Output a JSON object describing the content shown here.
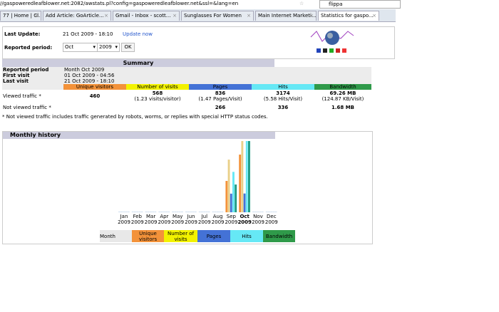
{
  "browser": {
    "url": "//gaspoweredleafblower.net:2082/awstats.pl?config=gaspoweredleafblower.net&ssl=&lang=en",
    "search": "flippa",
    "tabs": [
      {
        "label": "77 | Home | Cl..."
      },
      {
        "label": "Add Article: GoArticle..."
      },
      {
        "label": "Gmail - Inbox - scott..."
      },
      {
        "label": "Sunglasses For Women"
      },
      {
        "label": "Main Internet Marketi..."
      },
      {
        "label": "Statistics for gaspo...",
        "active": true
      }
    ]
  },
  "header": {
    "last_update_label": "Last Update:",
    "last_update": "21 Oct 2009 - 18:10",
    "update_now": "Update now",
    "period_label": "Reported period:",
    "month": "Oct",
    "year": "2009",
    "ok": "OK"
  },
  "summary": {
    "title": "Summary",
    "reported_period_label": "Reported period",
    "reported_period": "Month Oct 2009",
    "first_visit_label": "First visit",
    "first_visit": "01 Oct 2009 - 04:56",
    "last_visit_label": "Last visit",
    "last_visit": "21 Oct 2009 - 18:10",
    "columns": [
      "Unique visitors",
      "Number of visits",
      "Pages",
      "Hits",
      "Bandwidth"
    ],
    "viewed_label": "Viewed traffic *",
    "viewed": [
      "460",
      "568",
      "836",
      "3174",
      "69.26 MB"
    ],
    "viewed_sub": [
      "",
      "(1.23 visits/visitor)",
      "(1.47 Pages/Visit)",
      "(5.58 Hits/Visit)",
      "(124.87 KB/Visit)"
    ],
    "not_viewed_label": "Not viewed traffic *",
    "not_viewed": [
      "",
      "",
      "266",
      "336",
      "1.68 MB"
    ],
    "footnote": "* Not viewed traffic includes traffic generated by robots, worms, or replies with special HTTP status codes."
  },
  "colors": {
    "unique": "#f3923a",
    "visits": "#f2f200",
    "visits_bar": "#ead089",
    "pages": "#4472d6",
    "hits": "#66e8f5",
    "bandwidth": "#2f9a4a",
    "bandwidth_bar": "#1f9a83"
  },
  "chart_data": {
    "type": "bar",
    "title": "Monthly history",
    "categories": [
      "Jan 2009",
      "Feb 2009",
      "Mar 2009",
      "Apr 2009",
      "May 2009",
      "Jun 2009",
      "Jul 2009",
      "Aug 2009",
      "Sep 2009",
      "Oct 2009",
      "Nov 2009",
      "Dec 2009"
    ],
    "month_labels": [
      "Jan",
      "Feb",
      "Mar",
      "Apr",
      "May",
      "Jun",
      "Jul",
      "Aug",
      "Sep",
      "Oct",
      "Nov",
      "Dec"
    ],
    "year_label": "2009",
    "highlight": "Oct",
    "series": [
      {
        "name": "Unique visitors",
        "values": [
          0,
          0,
          0,
          0,
          0,
          0,
          0,
          0,
          250,
          460,
          0,
          0
        ]
      },
      {
        "name": "Number of visits",
        "values": [
          0,
          0,
          0,
          0,
          0,
          0,
          0,
          0,
          420,
          568,
          0,
          0
        ]
      },
      {
        "name": "Pages",
        "values": [
          0,
          0,
          0,
          0,
          0,
          0,
          0,
          0,
          830,
          836,
          0,
          0
        ]
      },
      {
        "name": "Hits",
        "values": [
          0,
          0,
          0,
          0,
          0,
          0,
          0,
          0,
          1800,
          3174,
          0,
          0
        ]
      },
      {
        "name": "Bandwidth (MB)",
        "values": [
          0,
          0,
          0,
          0,
          0,
          0,
          0,
          0,
          27,
          69.26,
          0,
          0
        ]
      }
    ],
    "legend": [
      "Month",
      "Unique visitors",
      "Number of visits",
      "Pages",
      "Hits",
      "Bandwidth"
    ],
    "legend_placement": "bottom"
  }
}
